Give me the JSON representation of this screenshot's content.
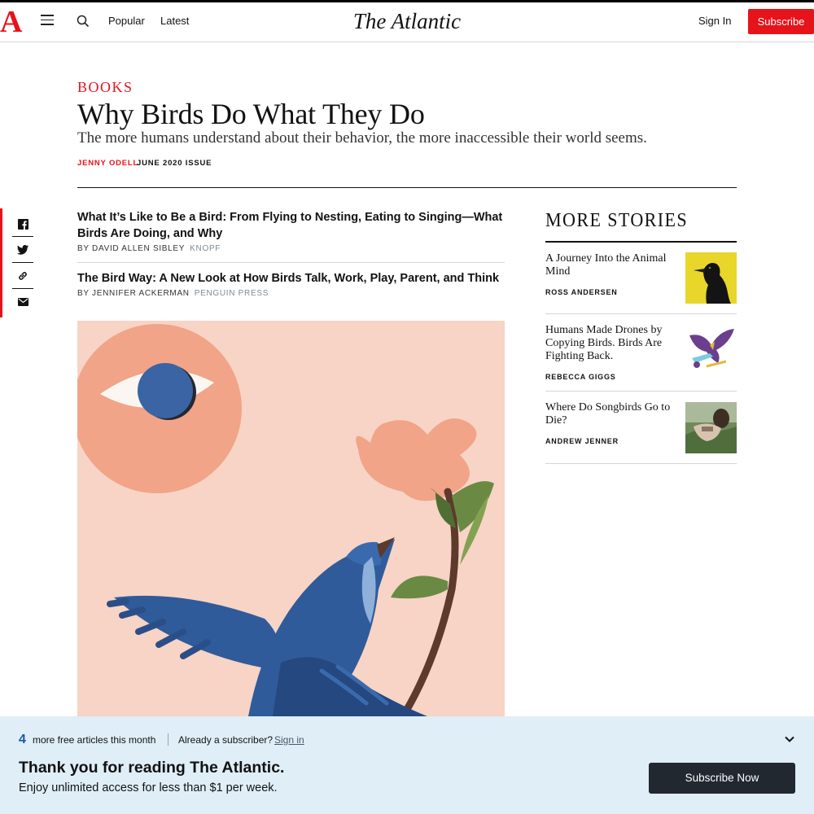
{
  "header": {
    "logo_letter": "A",
    "brand": "The Atlantic",
    "nav": [
      "Popular",
      "Latest"
    ],
    "sign_in": "Sign In",
    "subscribe": "Subscribe"
  },
  "article": {
    "section": "BOOKS",
    "title": "Why Birds Do What They Do",
    "dek": "The more humans understand about their behavior, the more inaccessible their world seems.",
    "author": "JENNY ODELL",
    "issue": "JUNE 2020 ISSUE"
  },
  "share": {
    "icons": [
      "facebook-icon",
      "twitter-icon",
      "link-icon",
      "email-icon"
    ]
  },
  "books": [
    {
      "title": "What It’s Like to Be a Bird: From Flying to Nesting, Eating to Singing—What Birds Are Doing, and Why",
      "author": "BY DAVID ALLEN SIBLEY",
      "publisher": "KNOPF"
    },
    {
      "title": "The Bird Way: A New Look at How Birds Talk, Work, Play, Parent, and Think",
      "author": "BY JENNIFER ACKERMAN",
      "publisher": "PENGUIN PRESS"
    }
  ],
  "more_stories": {
    "heading": "MORE STORIES",
    "items": [
      {
        "title": "A Journey Into the Animal Mind",
        "author": "ROSS ANDERSEN"
      },
      {
        "title": "Humans Made Drones by Copying Birds. Birds Are Fighting Back.",
        "author": "REBECCA GIGGS"
      },
      {
        "title": "Where Do Songbirds Go to Die?",
        "author": "ANDREW JENNER"
      }
    ]
  },
  "paywall": {
    "count": "4",
    "count_label": "more free articles this month",
    "already": "Already a subscriber?",
    "sign_in": "Sign in",
    "heading": "Thank you for reading The Atlantic.",
    "sub": "Enjoy unlimited access for less than $1 per week.",
    "button": "Subscribe Now"
  },
  "colors": {
    "brand_red": "#e7131a",
    "paywall_bg": "#dfeef7",
    "button_dark": "#222830",
    "illustration_bg": "#f7d4c5",
    "bird_blue": "#2f5b9a"
  }
}
